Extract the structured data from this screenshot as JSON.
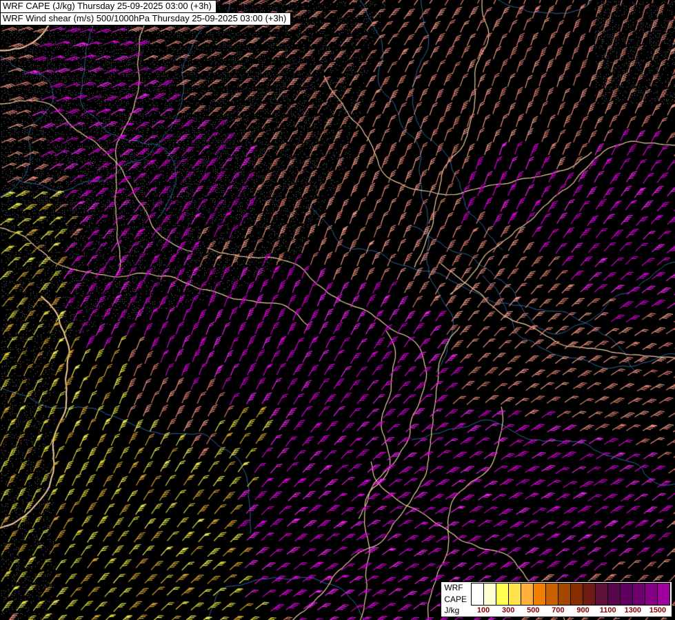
{
  "header": {
    "line1": "WRF CAPE (J/kg) Thursday 25-09-2025 03:00 (+3h)",
    "line2": "WRF Wind shear (m/s) 500/1000hPa Thursday 25-09-2025 03:00 (+3h)"
  },
  "legend": {
    "model_label": "WRF",
    "parameter_label": "CAPE",
    "units_label": "J/kg",
    "scale_min": 0,
    "scale_max": 1600,
    "tick_values": [
      100,
      300,
      500,
      700,
      900,
      1100,
      1300,
      1500
    ],
    "tick_labels": [
      "100",
      "300",
      "500",
      "700",
      "900",
      "1100",
      "1300",
      "1500"
    ],
    "tick_label_color": "#8b0000",
    "colors": [
      "#ffffff",
      "#ffffd2",
      "#ffff4f",
      "#ffe24a",
      "#ffb03a",
      "#f08000",
      "#c85f00",
      "#a34700",
      "#862e00",
      "#701c14",
      "#5e1038",
      "#58064e",
      "#60005e",
      "#6e006e",
      "#840084",
      "#a000a0"
    ]
  },
  "map": {
    "background_color": "#000000",
    "stipple_color": "rgba(215,215,215,0.55)",
    "border_color": "#f4cda2",
    "river_color": "#3c7fc0",
    "barb_palettes": {
      "salmon": [
        "#e8897a",
        "#f09886",
        "#dd7d6e"
      ],
      "magenta": [
        "#dd00dd",
        "#c800c8",
        "#ee22ee"
      ],
      "yellow": [
        "#ece94f",
        "#d9d23a",
        "#cfa030"
      ]
    }
  }
}
